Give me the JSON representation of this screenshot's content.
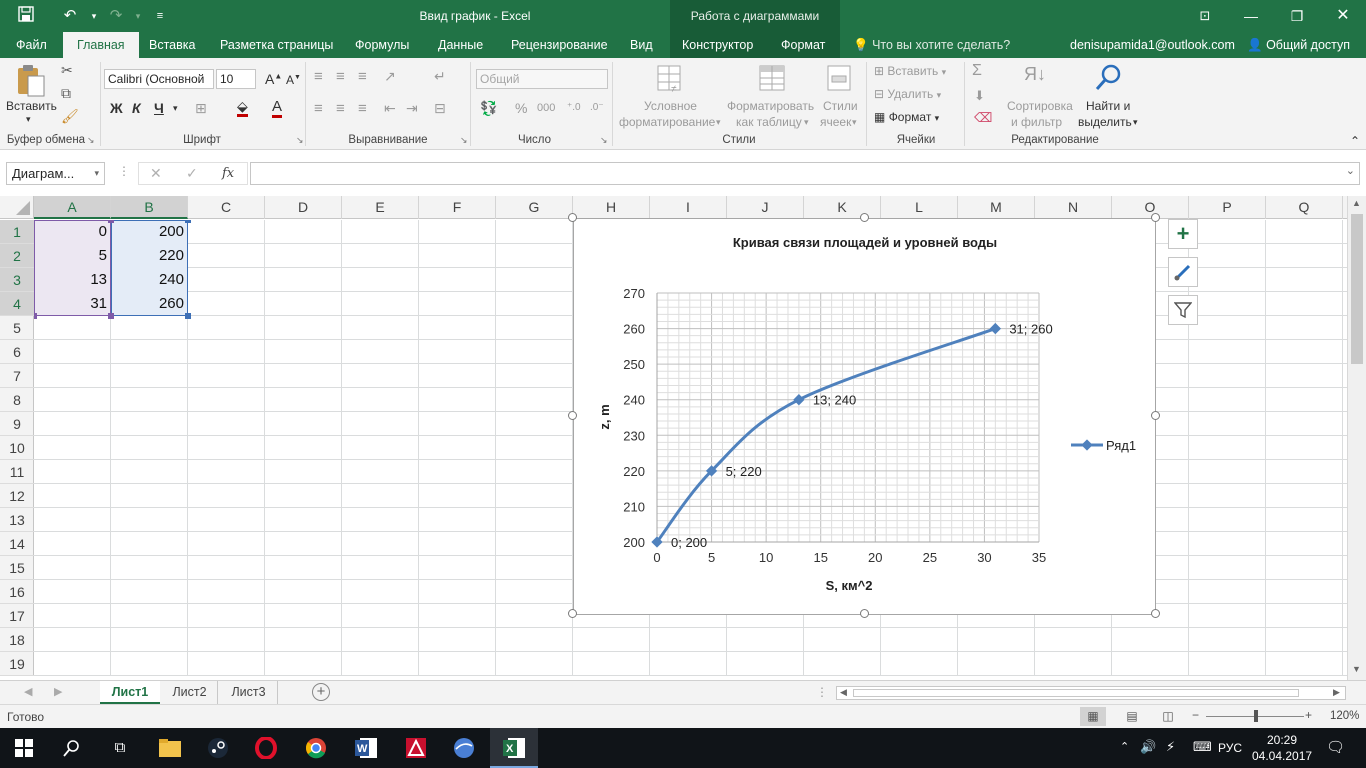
{
  "titlebar": {
    "document_title": "Ввид график - Excel",
    "context_title": "Работа с диаграммами"
  },
  "tabs": {
    "file": "Файл",
    "home": "Главная",
    "insert": "Вставка",
    "layout": "Разметка страницы",
    "formulas": "Формулы",
    "data": "Данные",
    "review": "Рецензирование",
    "view": "Вид",
    "design": "Конструктор",
    "format": "Формат",
    "tell_me": "Что вы хотите сделать?",
    "account": "denisupamida1@outlook.com",
    "share": "Общий доступ"
  },
  "ribbon": {
    "paste": "Вставить",
    "clipboard": "Буфер обмена",
    "font_name": "Calibri (Основной",
    "font_size": "10",
    "bold": "Ж",
    "italic": "К",
    "underline": "Ч",
    "font_group": "Шрифт",
    "alignment_group": "Выравнивание",
    "number_format": "Общий",
    "number_group": "Число",
    "conditional_1": "Условное",
    "conditional_2": "форматирование",
    "format_table_1": "Форматировать",
    "format_table_2": "как таблицу",
    "cell_styles_1": "Стили",
    "cell_styles_2": "ячеек",
    "styles_group": "Стили",
    "insert_cells": "Вставить",
    "delete_cells": "Удалить",
    "format_cells": "Формат",
    "cells_group": "Ячейки",
    "sort_1": "Сортировка",
    "sort_2": "и фильтр",
    "find_1": "Найти и",
    "find_2": "выделить",
    "editing_group": "Редактирование"
  },
  "formula_bar": {
    "name_box": "Диаграм...",
    "fx": "fx",
    "formula": ""
  },
  "grid": {
    "columns": [
      "A",
      "B",
      "C",
      "D",
      "E",
      "F",
      "G",
      "H",
      "I",
      "J",
      "K",
      "L",
      "M",
      "N",
      "O",
      "P",
      "Q"
    ],
    "rows": [
      "1",
      "2",
      "3",
      "4",
      "5",
      "6",
      "7",
      "8",
      "9",
      "10",
      "11",
      "12",
      "13",
      "14",
      "15",
      "16",
      "17",
      "18",
      "19"
    ],
    "data": [
      {
        "a": "0",
        "b": "200"
      },
      {
        "a": "5",
        "b": "220"
      },
      {
        "a": "13",
        "b": "240"
      },
      {
        "a": "31",
        "b": "260"
      }
    ]
  },
  "chart_data": {
    "type": "scatter",
    "title": "Кривая связи площадей и уровней воды",
    "xlabel": "S, км^2",
    "ylabel": "z, m",
    "xlim": [
      0,
      35
    ],
    "ylim": [
      200,
      270
    ],
    "x_ticks": [
      "0",
      "5",
      "10",
      "15",
      "20",
      "25",
      "30",
      "35"
    ],
    "y_ticks": [
      "200",
      "210",
      "220",
      "230",
      "240",
      "250",
      "260",
      "270"
    ],
    "grid": true,
    "smooth": true,
    "legend": "right",
    "series": [
      {
        "name": "Ряд1",
        "color": "#4f81bd",
        "points": [
          [
            0,
            200
          ],
          [
            5,
            220
          ],
          [
            13,
            240
          ],
          [
            31,
            260
          ]
        ],
        "labels": [
          "0; 200",
          "5; 220",
          "13; 240",
          "31; 260"
        ]
      }
    ]
  },
  "sheets": {
    "sheet1": "Лист1",
    "sheet2": "Лист2",
    "sheet3": "Лист3"
  },
  "status": {
    "ready": "Готово",
    "zoom": "120%"
  },
  "taskbar": {
    "language": "РУС",
    "time": "20:29",
    "date": "04.04.2017"
  },
  "colors": {
    "excel_green": "#217346",
    "series": "#4f81bd"
  }
}
